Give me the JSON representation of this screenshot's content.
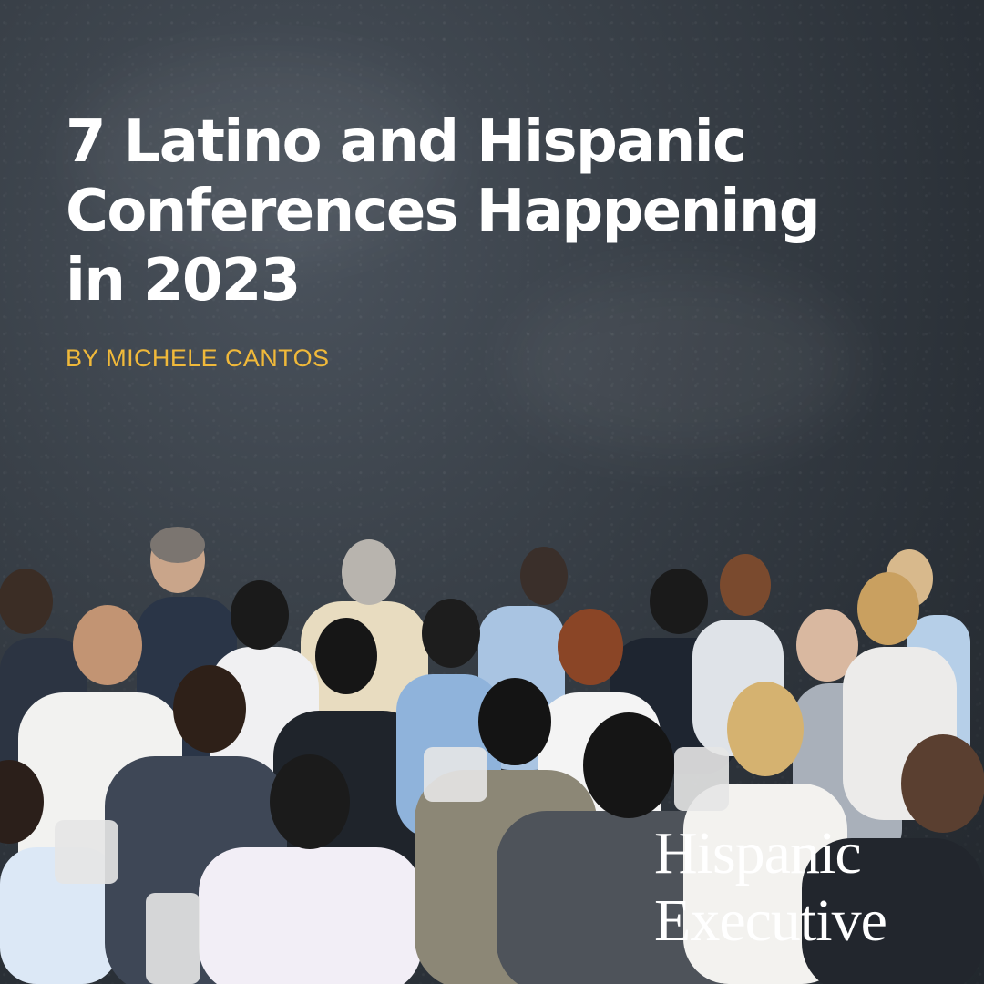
{
  "headline": {
    "line1": "7 Latino and Hispanic",
    "line2": "Conferences Happening",
    "line3": "in 2023"
  },
  "byline": "BY MICHELE CANTOS",
  "logo": {
    "line1": "Hispanic",
    "line2": "Executive"
  },
  "colors": {
    "background": "#2c323a",
    "headline": "#ffffff",
    "byline": "#f0b93a",
    "logo": "#ffffff"
  }
}
